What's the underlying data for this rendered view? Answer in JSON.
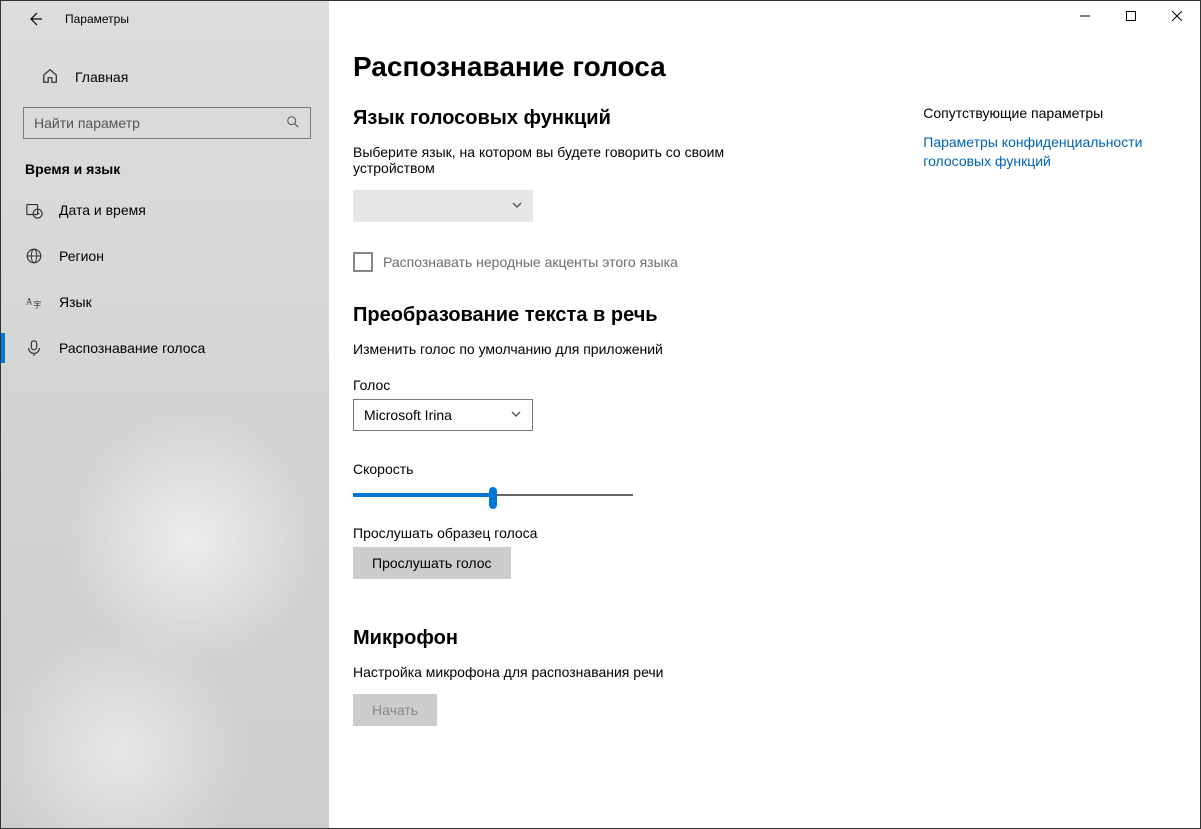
{
  "window": {
    "title": "Параметры"
  },
  "sidebar": {
    "home": "Главная",
    "search_placeholder": "Найти параметр",
    "category": "Время и язык",
    "items": [
      {
        "label": "Дата и время"
      },
      {
        "label": "Регион"
      },
      {
        "label": "Язык"
      },
      {
        "label": "Распознавание голоса"
      }
    ]
  },
  "page": {
    "title": "Распознавание голоса",
    "section_lang": {
      "heading": "Язык голосовых функций",
      "desc": "Выберите язык, на котором вы будете говорить со своим устройством",
      "dropdown_value": "",
      "checkbox_label": "Распознавать неродные акценты этого языка"
    },
    "section_tts": {
      "heading": "Преобразование текста в речь",
      "desc": "Изменить голос по умолчанию для приложений",
      "voice_label": "Голос",
      "voice_value": "Microsoft Irina",
      "speed_label": "Скорость",
      "preview_label": "Прослушать образец голоса",
      "preview_button": "Прослушать голос"
    },
    "section_mic": {
      "heading": "Микрофон",
      "desc": "Настройка микрофона для распознавания речи",
      "button": "Начать"
    }
  },
  "related": {
    "heading": "Сопутствующие параметры",
    "link": "Параметры конфиденциальности голосовых функций"
  }
}
